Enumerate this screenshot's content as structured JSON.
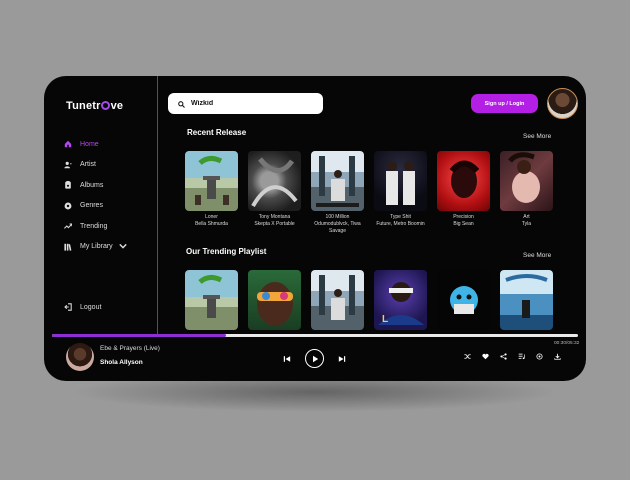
{
  "app": {
    "logo_prefix": "Tunetr",
    "logo_suffix": "ve"
  },
  "sidebar": {
    "items": [
      {
        "label": "Home",
        "icon": "home-icon"
      },
      {
        "label": "Artist",
        "icon": "artist-icon"
      },
      {
        "label": "Albums",
        "icon": "albums-icon"
      },
      {
        "label": "Genres",
        "icon": "genres-icon"
      },
      {
        "label": "Trending",
        "icon": "trending-icon"
      },
      {
        "label": "My Library",
        "icon": "library-icon"
      }
    ],
    "logout": "Logout"
  },
  "search": {
    "value": "Wizkid",
    "placeholder": ""
  },
  "header": {
    "signup": "Sign up / Login"
  },
  "recent": {
    "title": "Recent Release",
    "see_more": "See More",
    "cards": [
      {
        "title": "Loner",
        "subtitle": "Bella Shmurda"
      },
      {
        "title": "Tony Montana",
        "subtitle": "Skepta X Portable"
      },
      {
        "title": "100 Million",
        "subtitle": "Odumodublvck, Tiwa Savage"
      },
      {
        "title": "Type Shit",
        "subtitle": "Future, Metro Boomin"
      },
      {
        "title": "Precision",
        "subtitle": "Big Sean"
      },
      {
        "title": "Art",
        "subtitle": "Tyla"
      }
    ]
  },
  "trending": {
    "title": "Our Trending Playlist",
    "see_more": "See More"
  },
  "player": {
    "song": "Ebe & Prayers (Live)",
    "artist": "Shola Allyson",
    "time": "00:30/05:32",
    "progress": 0.33
  },
  "colors": {
    "accent": "#b41fe6",
    "active": "#b447f0"
  }
}
